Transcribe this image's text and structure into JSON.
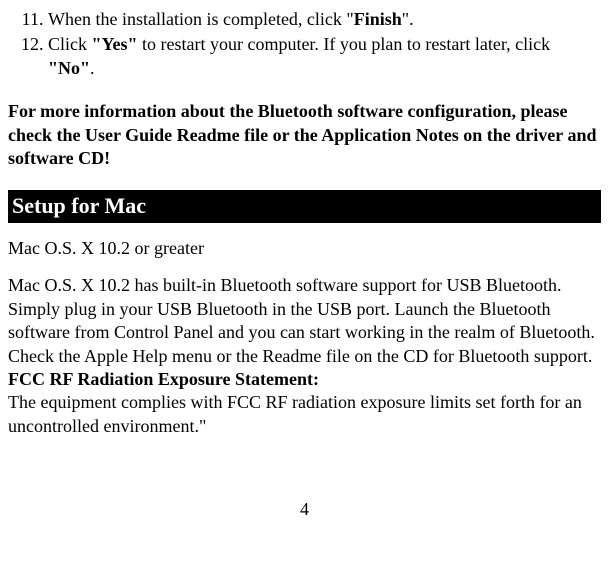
{
  "list": {
    "start": 11,
    "items": [
      {
        "pre": "When the installation is completed, click \"",
        "bold": "Finish",
        "post": "\"."
      },
      {
        "pre": "Click ",
        "bold1": "\"Yes\"",
        "mid": " to restart your computer. If you plan to restart later, click ",
        "bold2": "\"No\"",
        "post": "."
      }
    ]
  },
  "info": "For more information about the Bluetooth software configuration, please check the User Guide Readme file or the Application Notes on the driver and software CD!",
  "section_header": " Setup for Mac",
  "mac_req": "Mac O.S. X 10.2 or greater",
  "mac_body": "Mac O.S. X 10.2 has built-in Bluetooth software support for USB Bluetooth. Simply plug in your USB Bluetooth in the USB port. Launch the Bluetooth software from Control Panel and you can start working in the realm of Bluetooth. Check the Apple Help menu or the Readme file on the CD for Bluetooth support.",
  "fcc_heading": "FCC RF Radiation Exposure Statement:",
  "fcc_body": "The equipment complies with FCC RF radiation exposure limits set forth for an uncontrolled environment.\"",
  "page_number": "4"
}
